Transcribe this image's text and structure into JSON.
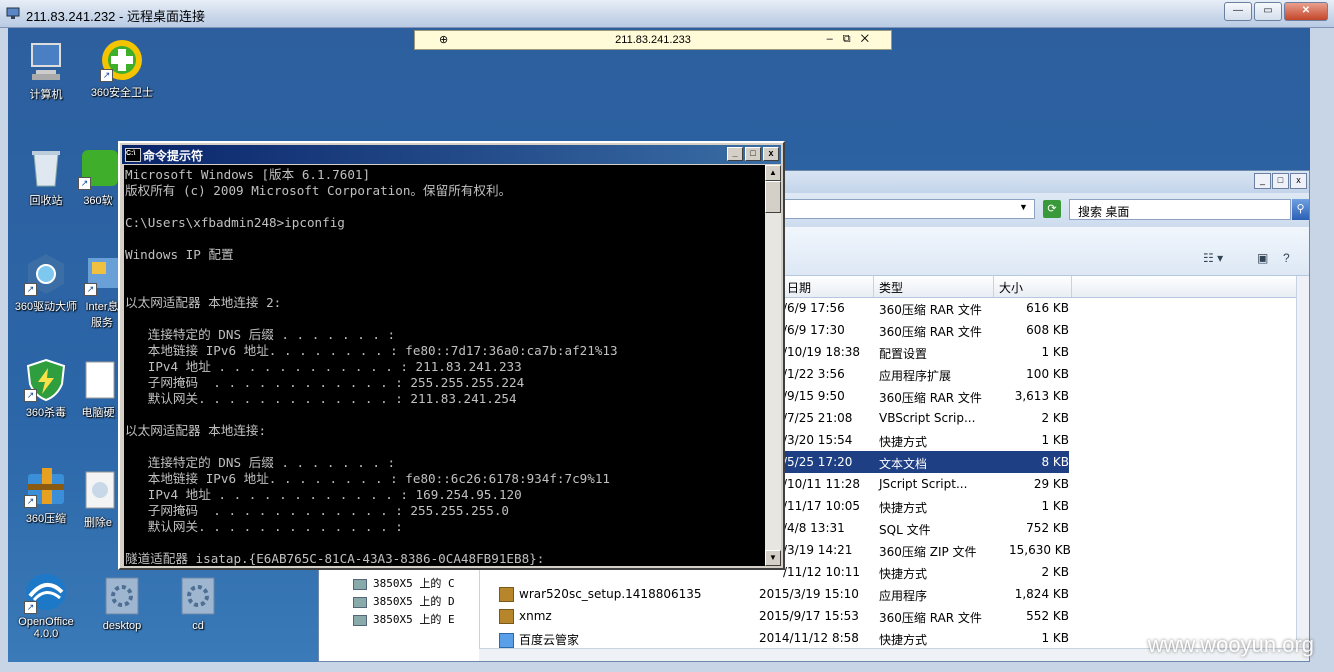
{
  "rdp": {
    "title": "211.83.241.232 - 远程桌面连接",
    "min": "—",
    "max": "▭",
    "close": "✕"
  },
  "connection_bar": {
    "host": "211.83.241.233",
    "pin": "⊕",
    "controls": "–⧉✕"
  },
  "desktop_icons": [
    {
      "label": "计算机",
      "icon": "computer-icon"
    },
    {
      "label": "360安全卫士",
      "icon": "360-guard-icon"
    },
    {
      "label": "回收站",
      "icon": "recycle-bin-icon"
    },
    {
      "label": "360软",
      "icon": "360-software-icon"
    },
    {
      "label": "360驱动大师",
      "icon": "360-driver-icon"
    },
    {
      "label": "Inter息服务",
      "icon": "iis-icon"
    },
    {
      "label": "360杀毒",
      "icon": "360-antivirus-icon"
    },
    {
      "label": "电脑硬",
      "icon": "hardware-icon"
    },
    {
      "label": "360压缩",
      "icon": "360-zip-icon"
    },
    {
      "label": "删除e",
      "icon": "delete-icon"
    },
    {
      "label": "OpenOffice 4.0.0",
      "icon": "openoffice-icon"
    },
    {
      "label": "desktop",
      "icon": "gear-file-icon"
    },
    {
      "label": "cd",
      "icon": "gear-file-icon"
    }
  ],
  "cmd": {
    "title": "命令提示符",
    "min": "_",
    "max": "□",
    "close": "x",
    "lines": [
      "Microsoft Windows [版本 6.1.7601]",
      "版权所有 (c) 2009 Microsoft Corporation。保留所有权利。",
      "",
      "C:\\Users\\xfbadmin248>ipconfig",
      "",
      "Windows IP 配置",
      "",
      "",
      "以太网适配器 本地连接 2:",
      "",
      "   连接特定的 DNS 后缀 . . . . . . . :",
      "   本地链接 IPv6 地址. . . . . . . . : fe80::7d17:36a0:ca7b:af21%13",
      "   IPv4 地址 . . . . . . . . . . . . : 211.83.241.233",
      "   子网掩码  . . . . . . . . . . . . : 255.255.255.224",
      "   默认网关. . . . . . . . . . . . . : 211.83.241.254",
      "",
      "以太网适配器 本地连接:",
      "",
      "   连接特定的 DNS 后缀 . . . . . . . :",
      "   本地链接 IPv6 地址. . . . . . . . : fe80::6c26:6178:934f:7c9%11",
      "   IPv4 地址 . . . . . . . . . . . . : 169.254.95.120",
      "   子网掩码  . . . . . . . . . . . . : 255.255.255.0",
      "   默认网关. . . . . . . . . . . . . :",
      "",
      "隧道适配器 isatap.{E6AB765C-81CA-43A3-8386-0CA48FB91EB8}:"
    ]
  },
  "explorer": {
    "search_label": "搜索 桌面",
    "columns": {
      "date": "日期",
      "type": "类型",
      "size": "大小"
    },
    "drives": [
      "3850X5 上的 C",
      "3850X5 上的 D",
      "3850X5 上的 E"
    ],
    "rows": [
      {
        "name": "",
        "date": "/6/9 17:56",
        "type": "360压缩 RAR 文件",
        "size": "616 KB"
      },
      {
        "name": "",
        "date": "/6/9 17:30",
        "type": "360压缩 RAR 文件",
        "size": "608 KB"
      },
      {
        "name": "",
        "date": "/10/19 18:38",
        "type": "配置设置",
        "size": "1 KB"
      },
      {
        "name": "",
        "date": "/1/22 3:56",
        "type": "应用程序扩展",
        "size": "100 KB"
      },
      {
        "name": "",
        "date": "/9/15 9:50",
        "type": "360压缩 RAR 文件",
        "size": "3,613 KB"
      },
      {
        "name": "",
        "date": "/7/25 21:08",
        "type": "VBScript Scrip...",
        "size": "2 KB"
      },
      {
        "name": "",
        "date": "/3/20 15:54",
        "type": "快捷方式",
        "size": "1 KB"
      },
      {
        "name": "",
        "date": "/5/25 17:20",
        "type": "文本文档",
        "size": "8 KB",
        "selected": true
      },
      {
        "name": "",
        "date": "/10/11 11:28",
        "type": "JScript Script...",
        "size": "29 KB"
      },
      {
        "name": "",
        "date": "/11/17 10:05",
        "type": "快捷方式",
        "size": "1 KB"
      },
      {
        "name": "",
        "date": "/4/8 13:31",
        "type": "SQL 文件",
        "size": "752 KB"
      },
      {
        "name": "",
        "date": "/3/19 14:21",
        "type": "360压缩 ZIP 文件",
        "size": "15,630 KB"
      },
      {
        "name": "",
        "date": "/11/12 10:11",
        "type": "快捷方式",
        "size": "2 KB"
      },
      {
        "name": "wrar520sc_setup.1418806135",
        "date": "2015/3/19 15:10",
        "type": "应用程序",
        "size": "1,824 KB"
      },
      {
        "name": "xnmz",
        "date": "2015/9/17 15:53",
        "type": "360压缩 RAR 文件",
        "size": "552 KB"
      },
      {
        "name": "百度云管家",
        "date": "2014/11/12 8:58",
        "type": "快捷方式",
        "size": "1 KB"
      }
    ]
  },
  "watermark": "www.wooyun.org"
}
